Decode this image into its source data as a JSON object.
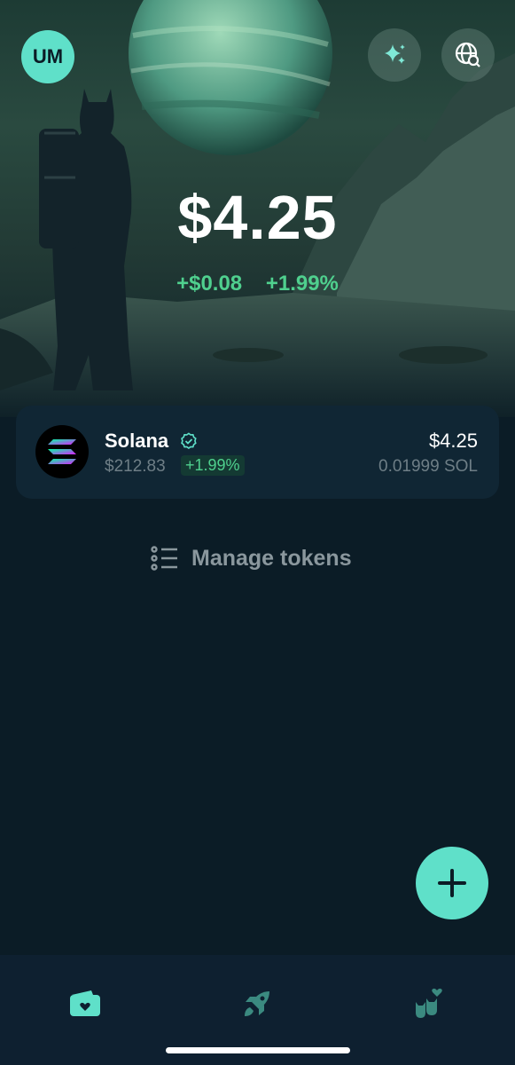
{
  "header": {
    "avatar_initials": "UM",
    "sparkle_icon": "sparkle-icon",
    "globe_search_icon": "globe-search-icon"
  },
  "portfolio": {
    "balance": "$4.25",
    "change_value": "+$0.08",
    "change_percent": "+1.99%"
  },
  "tokens": [
    {
      "name": "Solana",
      "price": "$212.83",
      "percent": "+1.99%",
      "value": "$4.25",
      "amount": "0.01999 SOL",
      "verified": true
    }
  ],
  "manage_tokens_label": "Manage tokens",
  "bottom_nav": {
    "items": [
      "wallet-icon",
      "rocket-icon",
      "cats-heart-icon"
    ]
  },
  "colors": {
    "accent": "#5fe0c9",
    "positive": "#4fd08e",
    "background": "#0b1c26",
    "card": "#102634"
  }
}
